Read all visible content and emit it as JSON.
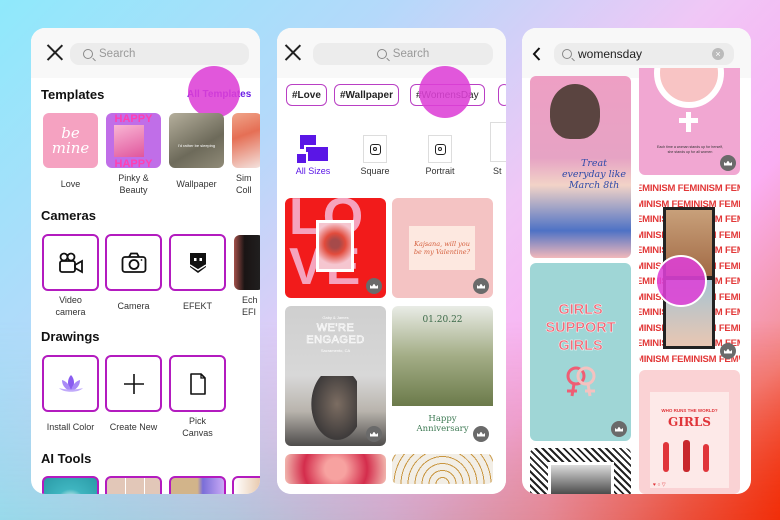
{
  "screen1": {
    "search_placeholder": "Search",
    "templates": {
      "title": "Templates",
      "all_link": "All Templates",
      "items": [
        {
          "label": "Love",
          "art": "be mine"
        },
        {
          "label": "Pinky &\nBeauty",
          "art": "HAPPY"
        },
        {
          "label": "Wallpaper",
          "art": "I'd rather be sleeping"
        },
        {
          "label": "Sim\nColl"
        }
      ]
    },
    "cameras": {
      "title": "Cameras",
      "items": [
        {
          "label": "Video\ncamera",
          "icon": "video-camera-icon"
        },
        {
          "label": "Camera",
          "icon": "camera-icon"
        },
        {
          "label": "EFEKT",
          "icon": "efekt-icon"
        },
        {
          "label": "Ech\nEFI"
        }
      ]
    },
    "drawings": {
      "title": "Drawings",
      "items": [
        {
          "label": "Install Color",
          "icon": "lotus-icon"
        },
        {
          "label": "Create New",
          "icon": "plus-icon"
        },
        {
          "label": "Pick\nCanvas",
          "icon": "document-icon"
        }
      ]
    },
    "ai_tools": {
      "title": "AI Tools"
    }
  },
  "screen2": {
    "search_placeholder": "Search",
    "chips": [
      "#Love",
      "#Wallpaper",
      "#WomensDay"
    ],
    "sizes": [
      {
        "label": "All Sizes",
        "icon": "all-sizes-icon",
        "selected": true
      },
      {
        "label": "Square",
        "icon": "instagram-icon"
      },
      {
        "label": "Portrait",
        "icon": "instagram-icon"
      },
      {
        "label": "St"
      }
    ],
    "cards": {
      "love": "LOVE",
      "valentine": "Kajsana, will you be my Valentine?",
      "engaged_names": "Gaby & James",
      "engaged_title": "WE'RE ENGAGED",
      "engaged_place": "Sacramento, CA",
      "anniv_date": "01.20.22",
      "anniv_text": "Happy Anniversary"
    }
  },
  "screen3": {
    "search_value": "womensday",
    "cards": {
      "march8": "Treat everyday like March 8th",
      "quote": "Each time a woman stands up for herself, she stands up for all women",
      "feminism": "FEMINISM",
      "girls_support": "GIRLS SUPPORT GIRLS",
      "who_runs": "WHO RUNS THE WORLD?",
      "girls": "GIRLS"
    }
  },
  "colors": {
    "accent": "#b31bbf",
    "touch": "#dd40d6",
    "link": "#6a1ee6",
    "selected": "#5a16e6"
  }
}
